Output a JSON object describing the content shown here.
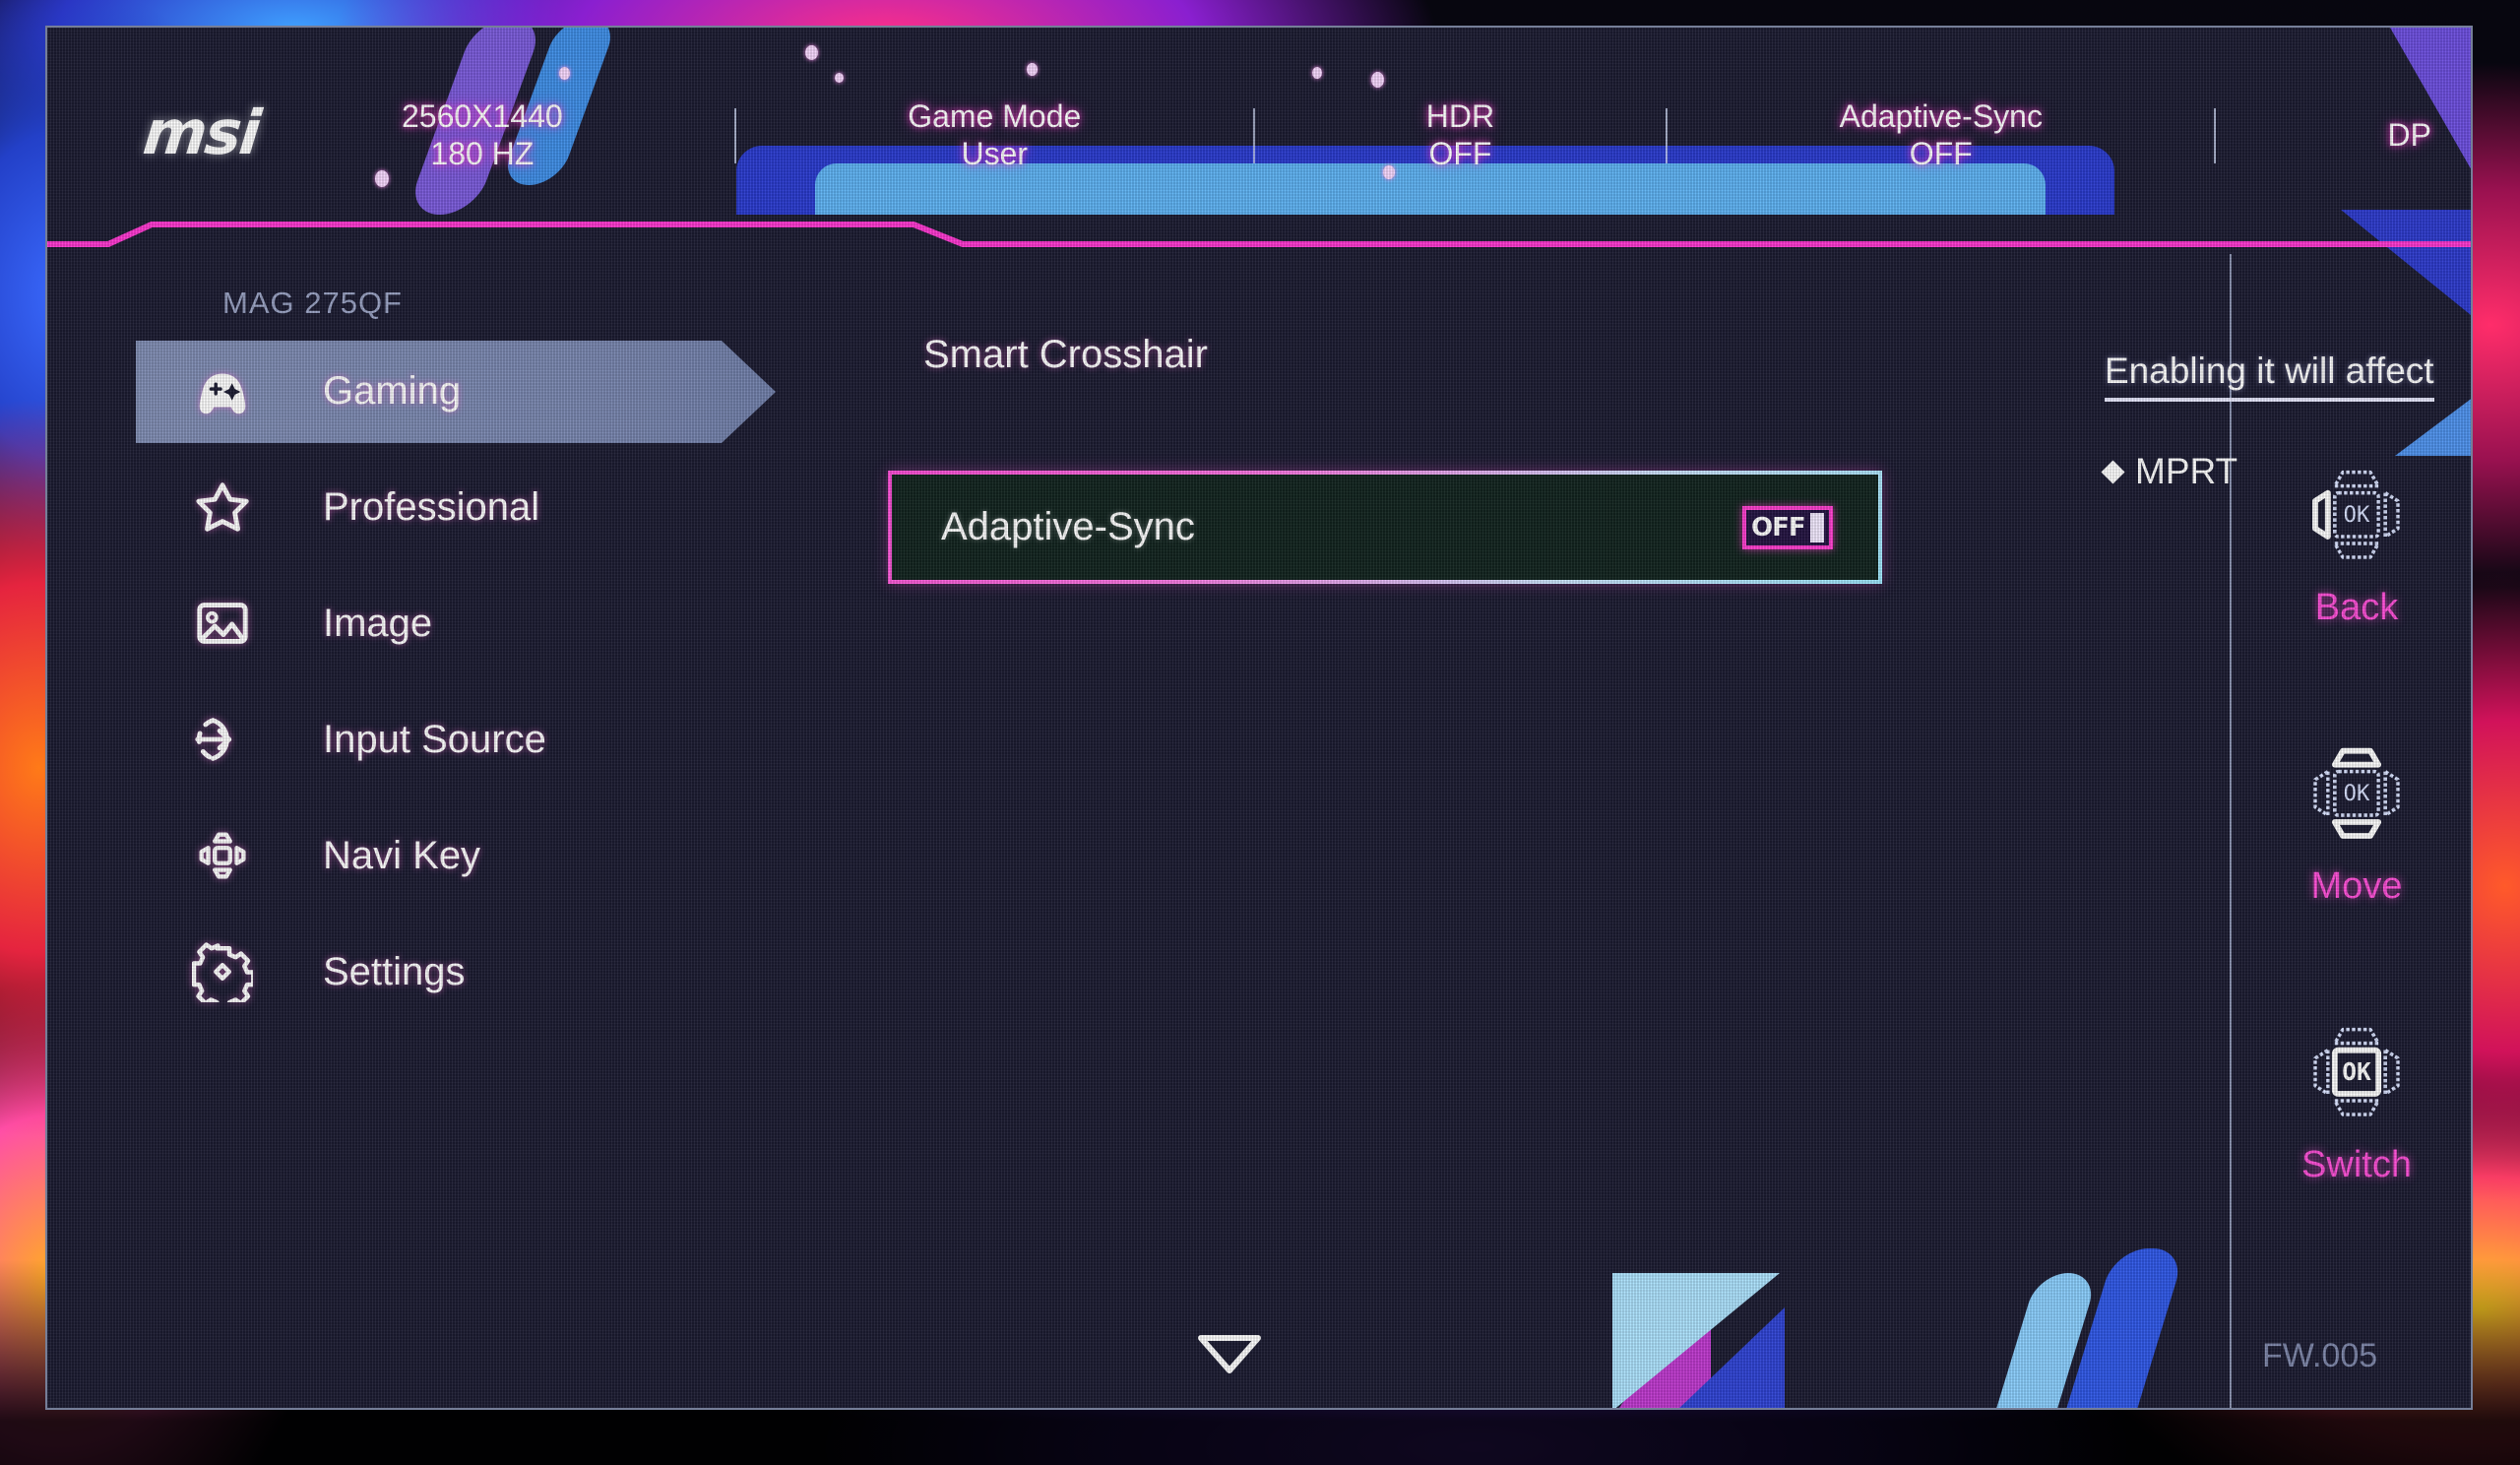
{
  "topbar": {
    "logo": "msi",
    "items": [
      {
        "key": "2560X1440",
        "value": "180 HZ"
      },
      {
        "key": "Game Mode",
        "value": "User"
      },
      {
        "key": "HDR",
        "value": "OFF"
      },
      {
        "key": "Adaptive-Sync",
        "value": "OFF"
      },
      {
        "key": "DP",
        "value": ""
      }
    ]
  },
  "sidebar": {
    "model": "MAG 275QF",
    "items": [
      {
        "label": "Gaming",
        "icon": "gamepad-icon",
        "selected": true
      },
      {
        "label": "Professional",
        "icon": "star-icon",
        "selected": false
      },
      {
        "label": "Image",
        "icon": "picture-icon",
        "selected": false
      },
      {
        "label": "Input Source",
        "icon": "input-arrow-icon",
        "selected": false
      },
      {
        "label": "Navi Key",
        "icon": "dpad-icon",
        "selected": false
      },
      {
        "label": "Settings",
        "icon": "gear-icon",
        "selected": false
      }
    ]
  },
  "content": {
    "section_title": "Smart Crosshair",
    "option": {
      "label": "Adaptive-Sync",
      "toggle_text": "OFF",
      "state": "OFF"
    },
    "info": {
      "title": "Enabling it will affect",
      "items": [
        "MPRT"
      ]
    }
  },
  "rail": {
    "items": [
      {
        "label": "Back",
        "icon": "navpad-left-icon",
        "center": "OK"
      },
      {
        "label": "Move",
        "icon": "navpad-updown-icon",
        "center": "OK"
      },
      {
        "label": "Switch",
        "icon": "navpad-center-icon",
        "center": "OK"
      }
    ]
  },
  "footer": {
    "firmware": "FW.005",
    "scroll_indicator": "chevron-down-icon"
  },
  "colors": {
    "accent_pink": "#ff4fd8",
    "panel_bg": "#1c1c32",
    "highlight": "#a9bbe8",
    "option_bg": "#12241f",
    "muted_text": "#7f88ab"
  }
}
